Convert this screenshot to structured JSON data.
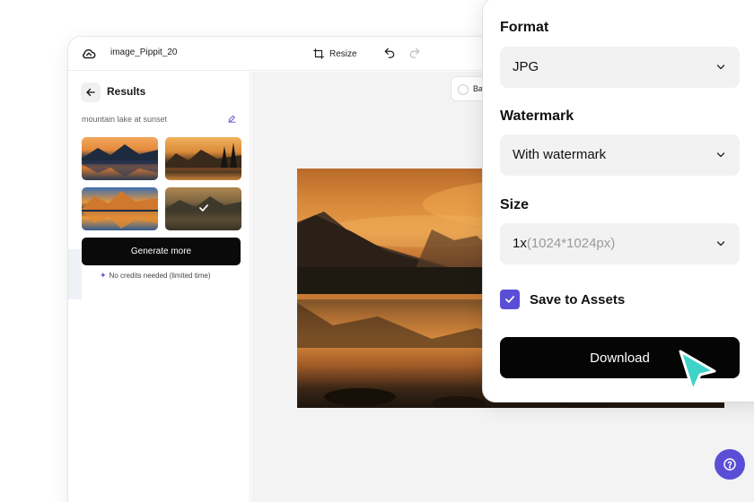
{
  "topbar": {
    "file_name": "image_Pippit_20",
    "resize_label": "Resize"
  },
  "sidebar": {
    "title": "Results",
    "prompt": "mountain lake at sunset",
    "generate_label": "Generate more",
    "credits_note": "No credits needed (limited time)",
    "selected_thumbnail": 4
  },
  "canvas": {
    "background_chip_label": "Ba"
  },
  "panel": {
    "format_label": "Format",
    "format_value": "JPG",
    "watermark_label": "Watermark",
    "watermark_value": "With watermark",
    "size_label": "Size",
    "size_value_main": "1x",
    "size_value_detail": "(1024*1024px)",
    "save_label": "Save to Assets",
    "save_checked": true,
    "download_label": "Download"
  },
  "colors": {
    "accent": "#5b4ed6",
    "cursor": "#3fd3c8",
    "primary_button": "#050505"
  },
  "icons": {
    "logo": "cloud-logo-icon",
    "resize": "resize-icon",
    "undo": "undo-icon",
    "redo": "redo-icon",
    "back": "arrow-left-icon",
    "edit": "pencil-icon",
    "help": "question-mark-icon",
    "cursor": "pointer-cursor-icon"
  }
}
